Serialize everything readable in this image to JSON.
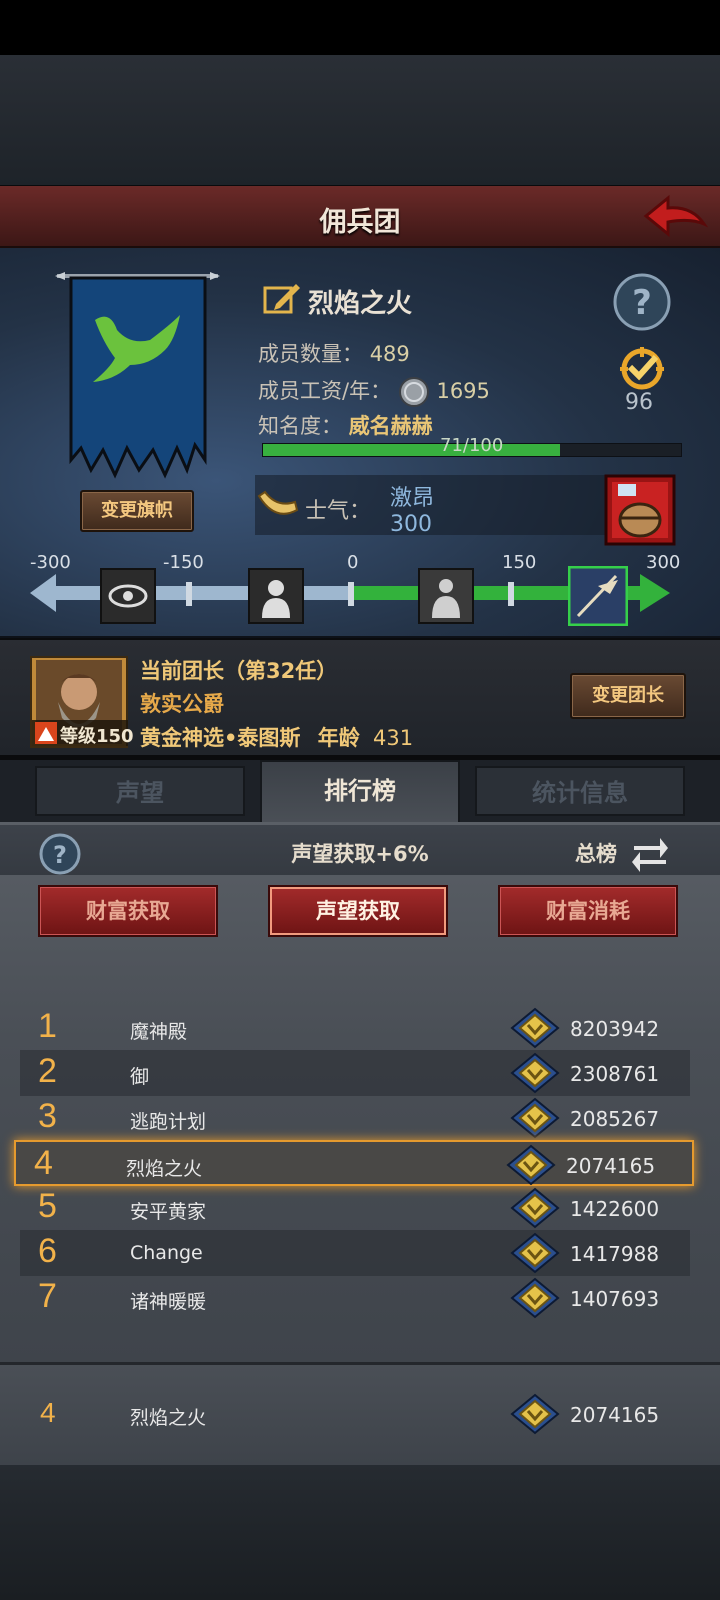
{
  "header": {
    "title": "佣兵团"
  },
  "guild": {
    "name": "烈焰之火",
    "members_label": "成员数量：",
    "members_value": "489",
    "salary_label": "成员工资/年：",
    "salary_value": "1695",
    "fame_label": "知名度：",
    "fame_value": "威名赫赫",
    "fame_progress_text": "71/100",
    "fame_progress": 0.71,
    "badge_value": "96",
    "change_banner_label": "变更旗帜",
    "morale_label": "士气：",
    "morale_state": "激昂",
    "morale_value": "300"
  },
  "morale_scale": {
    "ticks": [
      "-300",
      "-150",
      "0",
      "150",
      "300"
    ]
  },
  "leader": {
    "title": "当前团长（第32任）",
    "rank_title": "敦实公爵",
    "name": "黄金神选•泰图斯",
    "age_label": "年龄",
    "age_value": "431",
    "level_label": "等级150",
    "change_leader_label": "变更团长"
  },
  "tabs": [
    {
      "label": "声望",
      "active": false
    },
    {
      "label": "排行榜",
      "active": true
    },
    {
      "label": "统计信息",
      "active": false
    }
  ],
  "ranking": {
    "header": "声望获取+6%",
    "scope_label": "总榜",
    "categories": [
      {
        "label": "财富获取",
        "active": false
      },
      {
        "label": "声望获取",
        "active": true
      },
      {
        "label": "财富消耗",
        "active": false
      }
    ],
    "rows": [
      {
        "rank": "1",
        "name": "魔神殿",
        "score": "8203942"
      },
      {
        "rank": "2",
        "name": "御",
        "score": "2308761"
      },
      {
        "rank": "3",
        "name": "逃跑计划",
        "score": "2085267"
      },
      {
        "rank": "4",
        "name": "烈焰之火",
        "score": "2074165"
      },
      {
        "rank": "5",
        "name": "安平黄家",
        "score": "1422600"
      },
      {
        "rank": "6",
        "name": "Change",
        "score": "1417988"
      },
      {
        "rank": "7",
        "name": "诸神暖暖",
        "score": "1407693"
      }
    ],
    "my_row": {
      "rank": "4",
      "name": "烈焰之火",
      "score": "2074165"
    }
  },
  "colors": {
    "accent_gold": "#f2b24a",
    "progress_green": "#38b03f",
    "button_red": "#a32b2b"
  }
}
